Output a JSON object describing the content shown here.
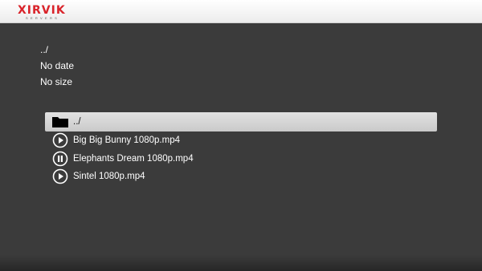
{
  "header": {
    "logo_text": "XIRVIK",
    "logo_subtext": "SERVERS",
    "brand_color": "#d9232a"
  },
  "info": {
    "path": "../",
    "date": "No date",
    "size": "No size"
  },
  "files": [
    {
      "label": "../",
      "icon": "folder-icon",
      "selected": true
    },
    {
      "label": "Big Big Bunny 1080p.mp4",
      "icon": "play-icon",
      "selected": false
    },
    {
      "label": "Elephants Dream 1080p.mp4",
      "icon": "pause-icon",
      "selected": false
    },
    {
      "label": "Sintel 1080p.mp4",
      "icon": "play-icon",
      "selected": false
    }
  ]
}
